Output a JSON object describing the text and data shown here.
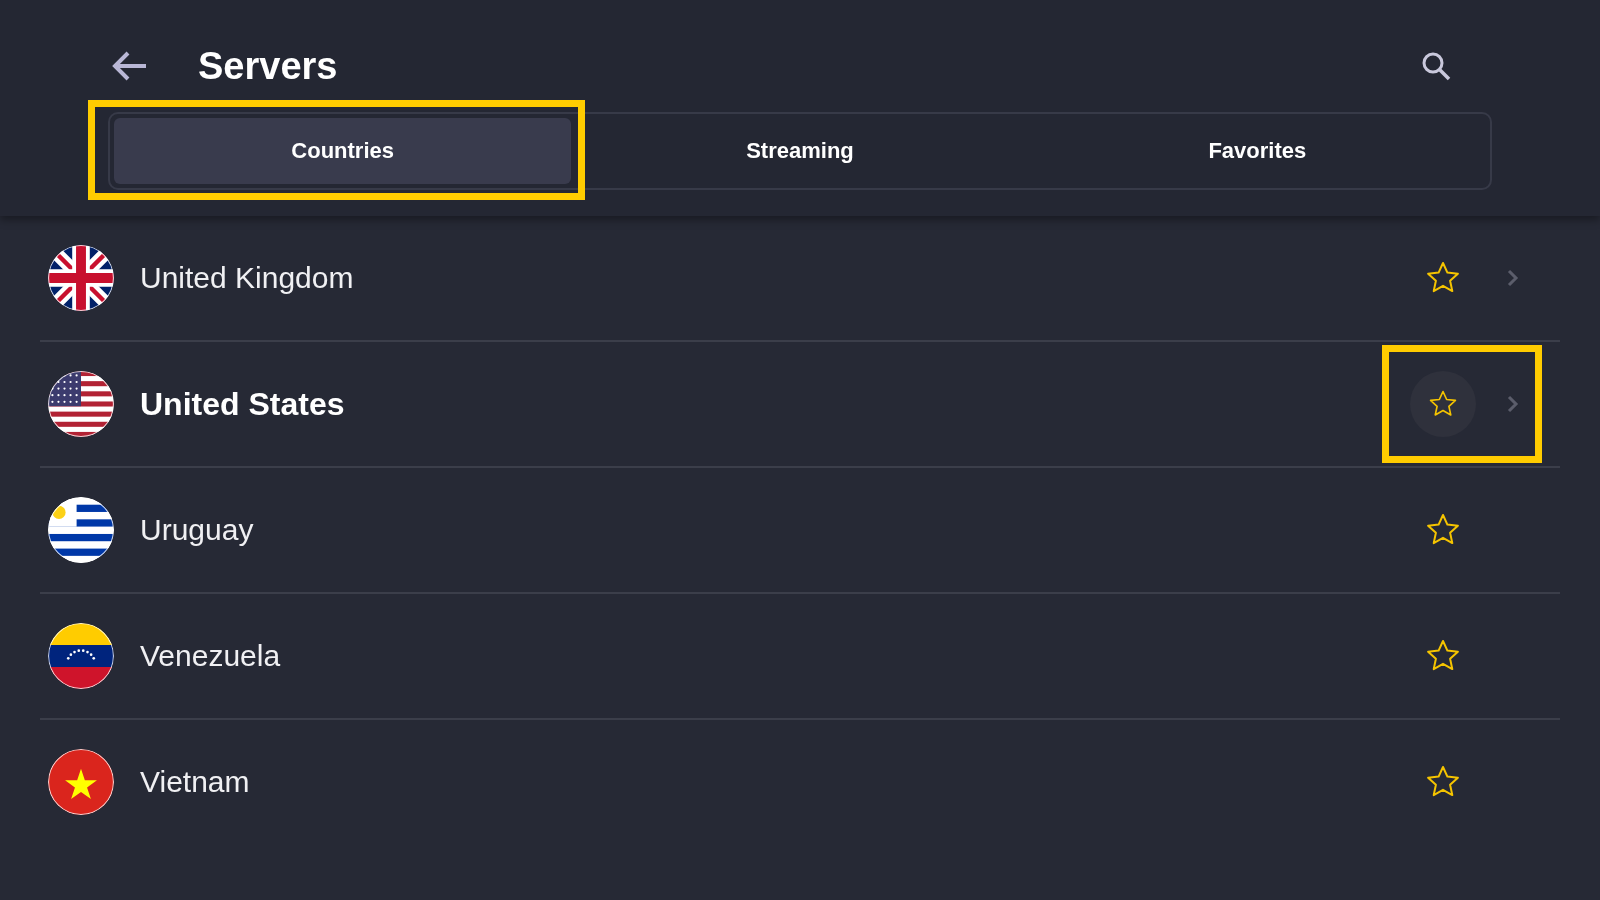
{
  "header": {
    "title": "Servers"
  },
  "tabs": [
    {
      "label": "Countries",
      "selected": true,
      "highlighted": true
    },
    {
      "label": "Streaming",
      "selected": false,
      "highlighted": false
    },
    {
      "label": "Favorites",
      "selected": false,
      "highlighted": false
    }
  ],
  "countries": [
    {
      "name": "United Kingdom",
      "kind": "uk",
      "focused": false,
      "chevron": true,
      "highlighted": false
    },
    {
      "name": "United States",
      "kind": "us",
      "focused": true,
      "chevron": true,
      "highlighted": true
    },
    {
      "name": "Uruguay",
      "kind": "uy",
      "focused": false,
      "chevron": false,
      "highlighted": false
    },
    {
      "name": "Venezuela",
      "kind": "ve",
      "focused": false,
      "chevron": false,
      "highlighted": false
    },
    {
      "name": "Vietnam",
      "kind": "vn",
      "focused": false,
      "chevron": false,
      "highlighted": false
    }
  ]
}
